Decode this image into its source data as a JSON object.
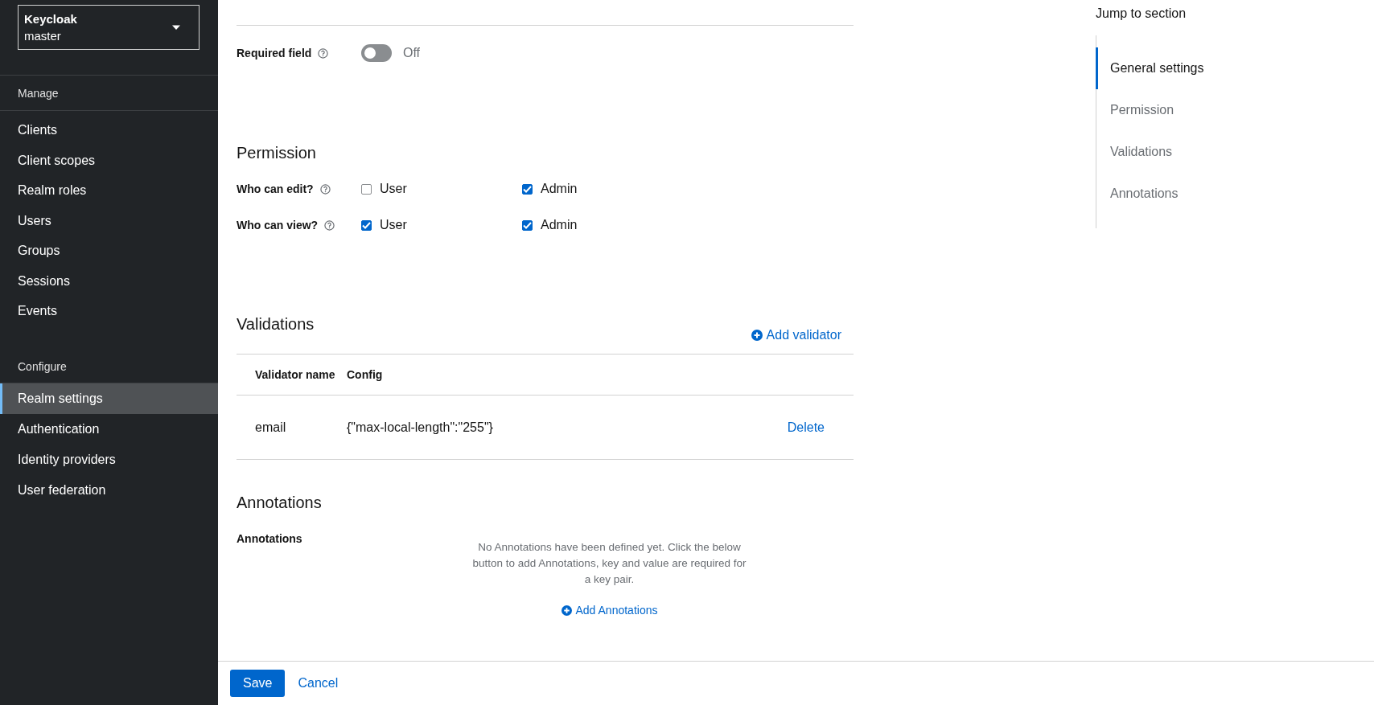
{
  "sidebar": {
    "realm_selector": {
      "title": "Keycloak",
      "value": "master"
    },
    "sections": [
      {
        "title": "Manage",
        "items": [
          {
            "label": "Clients",
            "selected": false
          },
          {
            "label": "Client scopes",
            "selected": false
          },
          {
            "label": "Realm roles",
            "selected": false
          },
          {
            "label": "Users",
            "selected": false
          },
          {
            "label": "Groups",
            "selected": false
          },
          {
            "label": "Sessions",
            "selected": false
          },
          {
            "label": "Events",
            "selected": false
          }
        ]
      },
      {
        "title": "Configure",
        "items": [
          {
            "label": "Realm settings",
            "selected": true
          },
          {
            "label": "Authentication",
            "selected": false
          },
          {
            "label": "Identity providers",
            "selected": false
          },
          {
            "label": "User federation",
            "selected": false
          }
        ]
      }
    ]
  },
  "general": {
    "required_field": {
      "label": "Required field",
      "on": false,
      "state_text": "Off"
    }
  },
  "permission": {
    "heading": "Permission",
    "rows": [
      {
        "label": "Who can edit?",
        "options": [
          {
            "label": "User",
            "checked": false
          },
          {
            "label": "Admin",
            "checked": true
          }
        ]
      },
      {
        "label": "Who can view?",
        "options": [
          {
            "label": "User",
            "checked": true
          },
          {
            "label": "Admin",
            "checked": true
          }
        ]
      }
    ]
  },
  "validations": {
    "heading": "Validations",
    "add_button": "Add validator",
    "columns": [
      "Validator name",
      "Config"
    ],
    "rows": [
      {
        "name": "email",
        "config": "{\"max-local-length\":\"255\"}",
        "action": "Delete"
      }
    ]
  },
  "annotations": {
    "heading": "Annotations",
    "label": "Annotations",
    "empty_text": "No Annotations have been defined yet. Click the below button to add Annotations, key and value are required for a key pair.",
    "add_button": "Add Annotations"
  },
  "footer": {
    "save": "Save",
    "cancel": "Cancel"
  },
  "jump": {
    "title": "Jump to section",
    "items": [
      {
        "label": "General settings",
        "selected": true
      },
      {
        "label": "Permission",
        "selected": false
      },
      {
        "label": "Validations",
        "selected": false
      },
      {
        "label": "Annotations",
        "selected": false
      }
    ]
  }
}
